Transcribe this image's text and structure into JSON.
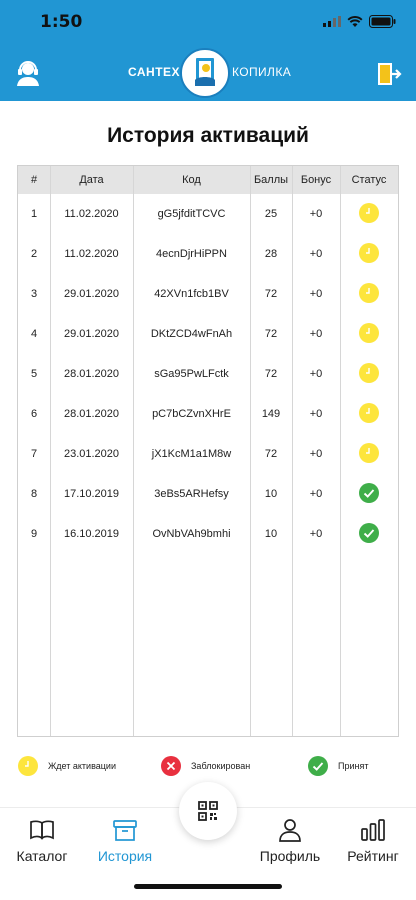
{
  "status_bar": {
    "time": "1:50"
  },
  "brand": {
    "left": "САНТЕХ",
    "right": "КОПИЛКА"
  },
  "page_title": "История активаций",
  "table": {
    "headers": [
      "#",
      "Дата",
      "Код",
      "Баллы",
      "Бонус",
      "Статус"
    ],
    "rows": [
      {
        "n": "1",
        "date": "11.02.2020",
        "code": "gG5jfditTCVC",
        "points": "25",
        "bonus": "+0",
        "status": "pending"
      },
      {
        "n": "2",
        "date": "11.02.2020",
        "code": "4ecnDjrHiPPN",
        "points": "28",
        "bonus": "+0",
        "status": "pending"
      },
      {
        "n": "3",
        "date": "29.01.2020",
        "code": "42XVn1fcb1BV",
        "points": "72",
        "bonus": "+0",
        "status": "pending"
      },
      {
        "n": "4",
        "date": "29.01.2020",
        "code": "DKtZCD4wFnAh",
        "points": "72",
        "bonus": "+0",
        "status": "pending"
      },
      {
        "n": "5",
        "date": "28.01.2020",
        "code": "sGa95PwLFctk",
        "points": "72",
        "bonus": "+0",
        "status": "pending"
      },
      {
        "n": "6",
        "date": "28.01.2020",
        "code": "pC7bCZvnXHrE",
        "points": "149",
        "bonus": "+0",
        "status": "pending"
      },
      {
        "n": "7",
        "date": "23.01.2020",
        "code": "jX1KcM1a1M8w",
        "points": "72",
        "bonus": "+0",
        "status": "pending"
      },
      {
        "n": "8",
        "date": "17.10.2019",
        "code": "3eBs5ARHefsy",
        "points": "10",
        "bonus": "+0",
        "status": "accepted"
      },
      {
        "n": "9",
        "date": "16.10.2019",
        "code": "OvNbVAh9bmhi",
        "points": "10",
        "bonus": "+0",
        "status": "accepted"
      }
    ]
  },
  "legend": {
    "pending": "Ждет активации",
    "blocked": "Заблокирован",
    "accepted": "Принят"
  },
  "colors": {
    "header": "#2196d3",
    "pending": "#fde53d",
    "blocked": "#e8303f",
    "accepted": "#3fae49",
    "active_tab": "#2196d3"
  },
  "nav": {
    "catalog": "Каталог",
    "history": "История",
    "profile": "Профиль",
    "rating": "Рейтинг"
  },
  "icons": [
    "support-icon",
    "logout-icon",
    "logo-icon",
    "qr-code-icon",
    "book-icon",
    "archive-icon",
    "user-icon",
    "bar-chart-icon",
    "clock-icon",
    "check-icon",
    "close-icon"
  ]
}
